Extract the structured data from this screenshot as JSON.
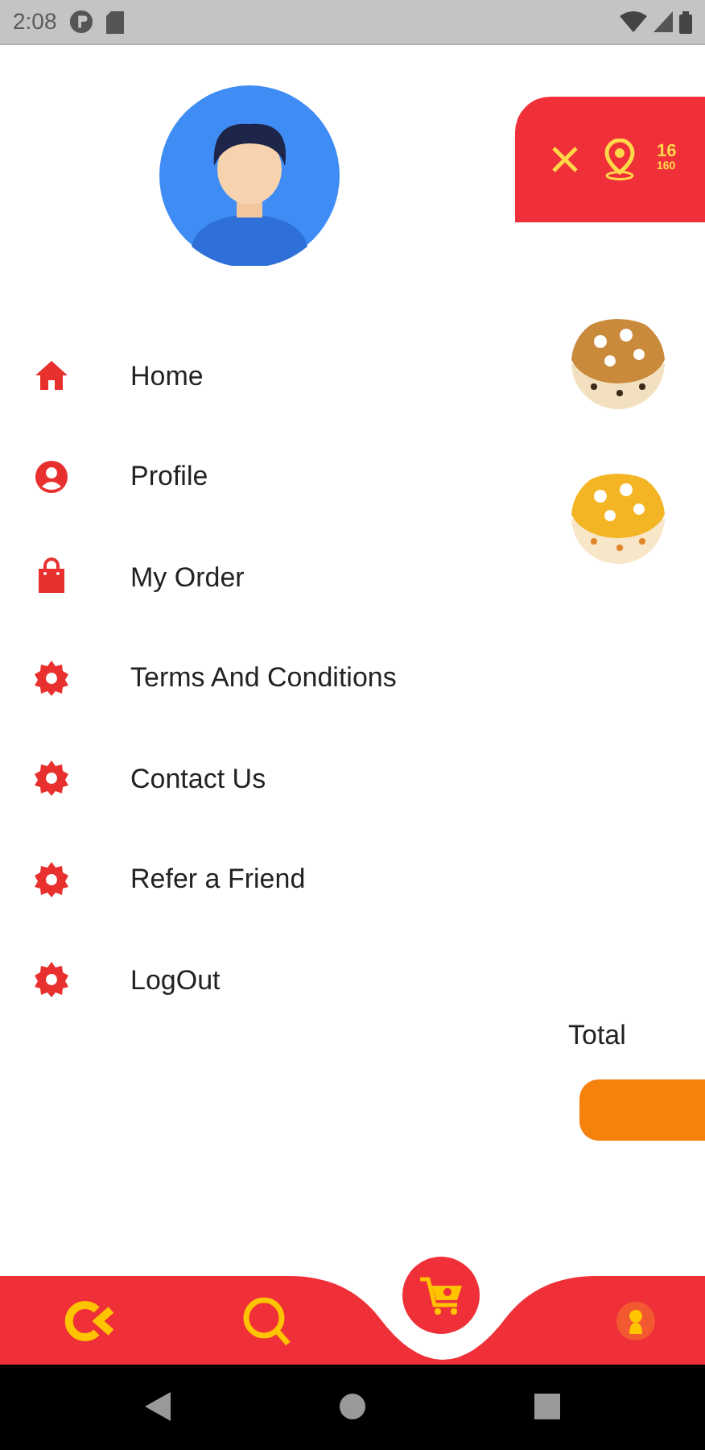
{
  "status_bar": {
    "time": "2:08"
  },
  "drawer": {
    "menu": [
      {
        "label": "Home",
        "kind": "home"
      },
      {
        "label": "Profile",
        "kind": "profile"
      },
      {
        "label": "My Order",
        "kind": "order"
      },
      {
        "label": "Terms And Conditions",
        "kind": "settings"
      },
      {
        "label": "Contact Us",
        "kind": "settings"
      },
      {
        "label": "Refer a Friend",
        "kind": "settings"
      },
      {
        "label": "LogOut",
        "kind": "settings"
      }
    ]
  },
  "behind_screen": {
    "header": {
      "line_1": "16",
      "line_2": "160"
    },
    "total_label": "Total"
  }
}
